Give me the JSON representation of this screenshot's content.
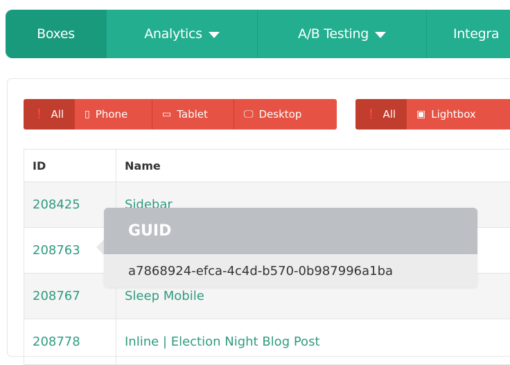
{
  "nav": {
    "items": [
      {
        "label": "Boxes",
        "active": true
      },
      {
        "label": "Analytics",
        "dropdown": true
      },
      {
        "label": "A/B Testing",
        "dropdown": true
      },
      {
        "label": "Integra"
      }
    ]
  },
  "filters": {
    "device": [
      {
        "label": "All",
        "icon": "exclamation-icon",
        "active": true
      },
      {
        "label": "Phone",
        "icon": "phone-icon"
      },
      {
        "label": "Tablet",
        "icon": "tablet-icon"
      },
      {
        "label": "Desktop",
        "icon": "desktop-icon"
      }
    ],
    "type": [
      {
        "label": "All",
        "icon": "exclamation-icon",
        "active": true
      },
      {
        "label": "Lightbox",
        "icon": "lightbox-icon"
      }
    ]
  },
  "table": {
    "headers": {
      "id": "ID",
      "name": "Name"
    },
    "rows": [
      {
        "id": "208425",
        "name": "Sidebar"
      },
      {
        "id": "208763",
        "name": ""
      },
      {
        "id": "208767",
        "name": "Sleep Mobile"
      },
      {
        "id": "208778",
        "name": "Inline | Election Night Blog Post"
      }
    ]
  },
  "popover": {
    "title": "GUID",
    "value": "a7868924-efca-4c4d-b570-0b987996a1ba"
  },
  "colors": {
    "nav_bg": "#22ae8f",
    "nav_active": "#1a9a7d",
    "filter_bg": "#e65344",
    "filter_active": "#c13d2e",
    "link": "#2e9b7f",
    "popover_head": "#bcc0c5"
  }
}
